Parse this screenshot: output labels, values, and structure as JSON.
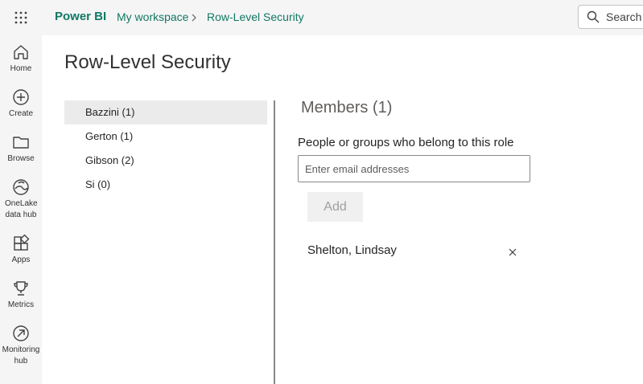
{
  "topbar": {
    "brand": "Power BI",
    "breadcrumb": [
      "My workspace",
      "Row-Level Security"
    ],
    "search_label": "Search"
  },
  "nav": [
    {
      "label": "Home",
      "icon": "home-icon"
    },
    {
      "label": "Create",
      "icon": "create-icon"
    },
    {
      "label": "Browse",
      "icon": "browse-icon"
    },
    {
      "label": "OneLake data hub",
      "icon": "onelake-icon"
    },
    {
      "label": "Apps",
      "icon": "apps-icon"
    },
    {
      "label": "Metrics",
      "icon": "trophy-icon"
    },
    {
      "label": "Monitoring hub",
      "icon": "monitoring-icon"
    }
  ],
  "page": {
    "title": "Row-Level Security"
  },
  "roles": [
    {
      "label": "Bazzini (1)",
      "selected": true
    },
    {
      "label": "Gerton (1)",
      "selected": false
    },
    {
      "label": "Gibson (2)",
      "selected": false
    },
    {
      "label": "Si (0)",
      "selected": false
    }
  ],
  "members": {
    "title": "Members (1)",
    "field_label": "People or groups who belong to this role",
    "input_placeholder": "Enter email addresses",
    "input_value": "",
    "add_label": "Add",
    "list": [
      {
        "name": "Shelton, Lindsay"
      }
    ]
  },
  "colors": {
    "brand_green": "#117865",
    "selected_row": "#ebebeb",
    "chrome_bg": "#f5f5f5"
  }
}
